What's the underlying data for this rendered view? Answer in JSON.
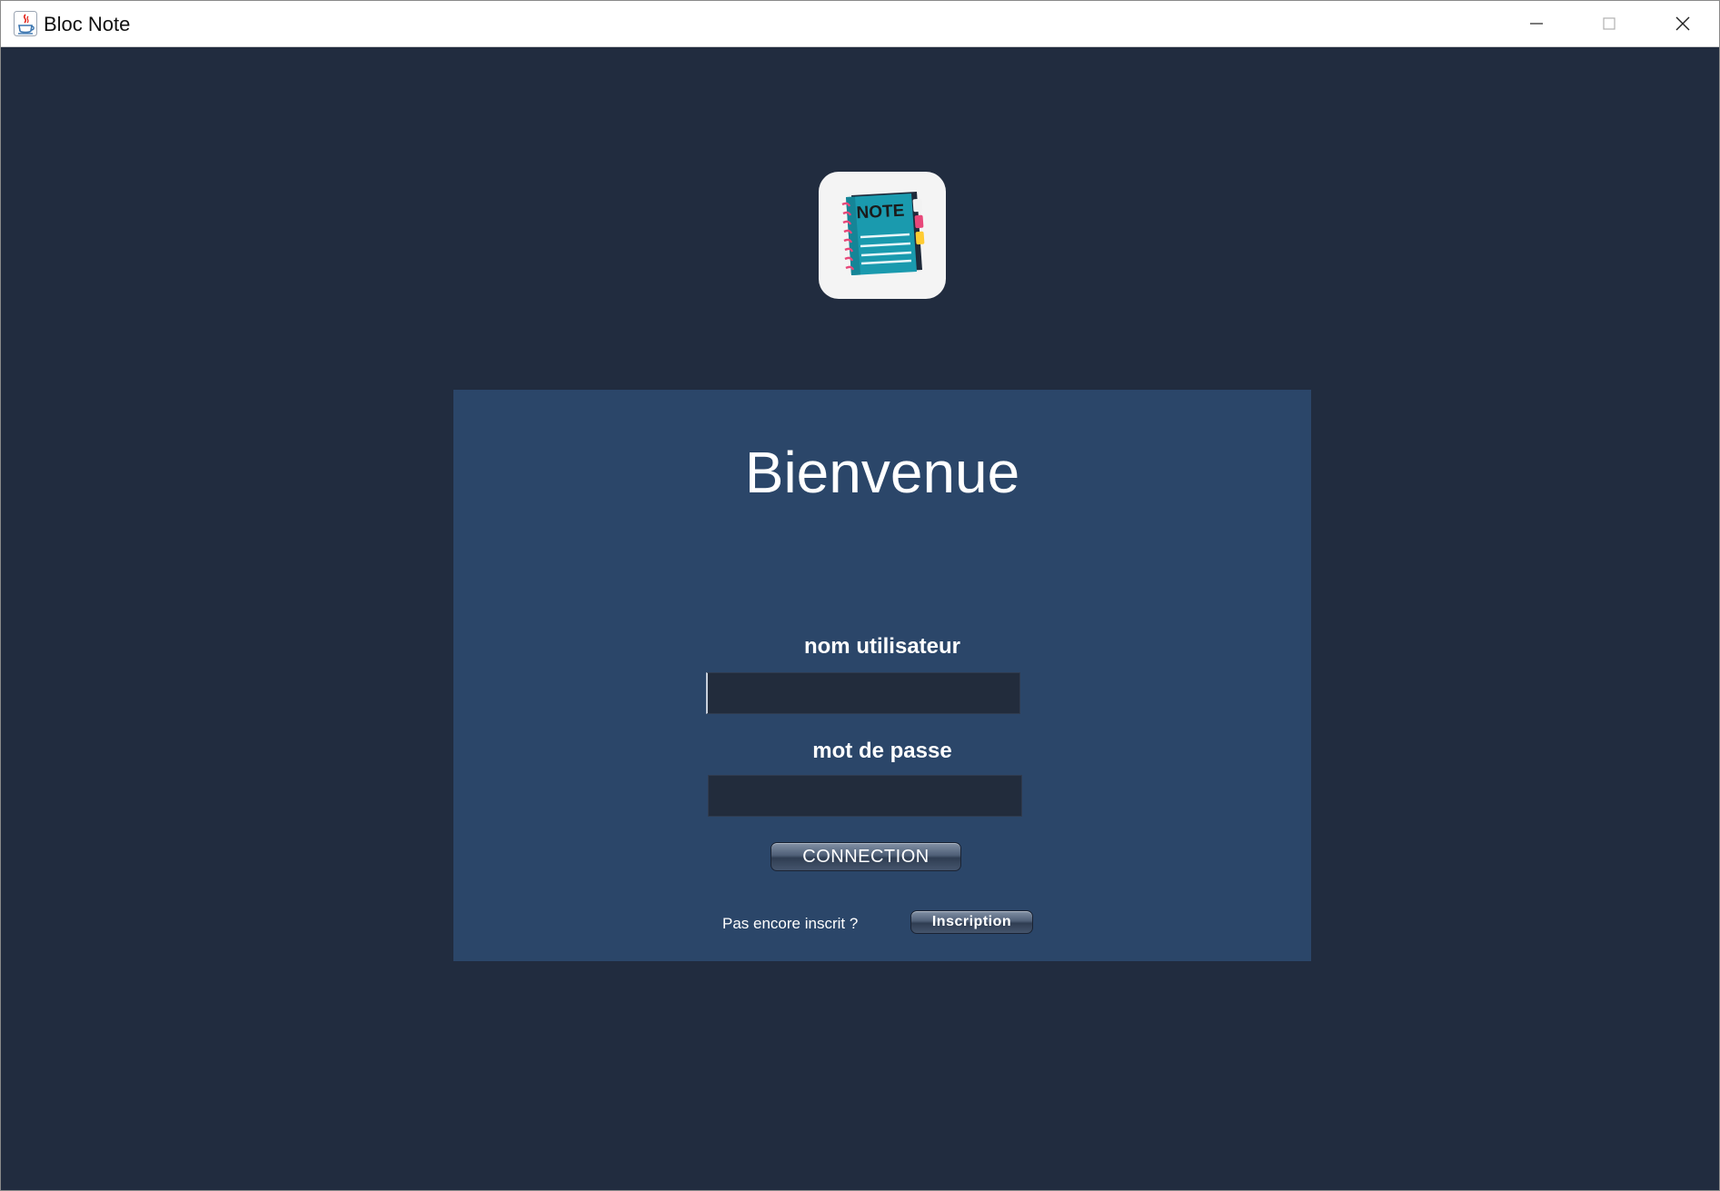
{
  "window": {
    "title": "Bloc Note",
    "controls": {
      "minimize_icon": "minimize-icon",
      "maximize_icon": "maximize-icon",
      "close_icon": "close-icon"
    }
  },
  "logo": {
    "label": "NOTE",
    "icon": "notebook-icon"
  },
  "login": {
    "heading": "Bienvenue",
    "username_label": "nom utilisateur",
    "username_value": "",
    "password_label": "mot de passe",
    "password_value": "",
    "connect_label": "CONNECTION",
    "signup_prompt": "Pas encore inscrit ?",
    "signup_label": "Inscription"
  },
  "colors": {
    "background": "#212c3f",
    "panel": "#2b4669",
    "input": "#222c3c",
    "notebook": "#1a9aae"
  }
}
